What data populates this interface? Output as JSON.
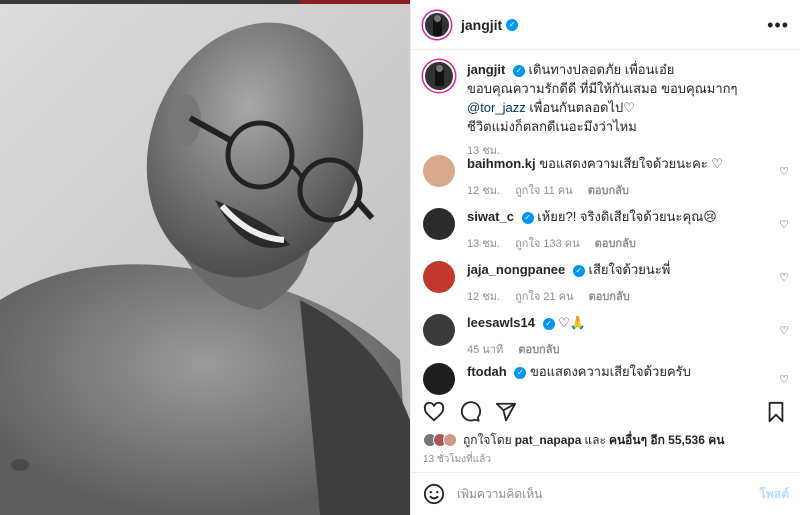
{
  "post": {
    "username": "jangjit",
    "more_icon": "more-horizontal-icon",
    "caption": {
      "username": "jangjit",
      "line1": "เดินทางปลอดภัย เพื่อนเอ๋ย",
      "line2": "ขอบคุณความรักดีดี ที่มีให้กันเสมอ ขอบคุณมากๆ",
      "mention": "@tor_jazz",
      "line3_rest": " เพื่อนกันตลอดไป♡",
      "line4": "ชีวิตแม่งก็ตลกดีเนอะมึงว่าไหม",
      "time": "13 ชม."
    }
  },
  "comments": [
    {
      "username": "baihmon.kj",
      "verified": false,
      "text": "ขอแสดงความเสียใจด้วยนะคะ ♡",
      "time": "12 ชม.",
      "likes": "ถูกใจ 11 คน",
      "reply": "ตอบกลับ",
      "avatar_color": "#d9a98c"
    },
    {
      "username": "siwat_c",
      "verified": true,
      "text": "เห้ยย?! จริงดิเสียใจด้วยนะคุณ😢",
      "time": "13 ชม.",
      "likes": "ถูกใจ 133 คน",
      "reply": "ตอบกลับ",
      "avatar_color": "#2b2b2b"
    },
    {
      "username": "jaja_nongpanee",
      "verified": true,
      "text": "เสียใจด้วยนะพี่",
      "time": "12 ชม.",
      "likes": "ถูกใจ 21 คน",
      "reply": "ตอบกลับ",
      "avatar_color": "#c0392b"
    },
    {
      "username": "leesawls14",
      "verified": true,
      "text": "♡🙏",
      "time": "45 นาที",
      "likes": "",
      "reply": "ตอบกลับ",
      "avatar_color": "#3a3a3a"
    },
    {
      "username": "ftodah",
      "verified": true,
      "text": "ขอแสดงความเสียใจด้วยครับ",
      "time": "",
      "likes": "",
      "reply": "",
      "avatar_color": "#1e1e1e"
    }
  ],
  "actions": {
    "like_icon": "heart-icon",
    "comment_icon": "comment-icon",
    "share_icon": "share-icon",
    "save_icon": "bookmark-icon"
  },
  "likes": {
    "prefix": "ถูกใจโดย",
    "user": "pat_napapa",
    "middle": "และ",
    "others": "คนอื่นๆ อีก 55,536 คน"
  },
  "timeago": "13 ชั่วโมงที่แล้ว",
  "add_comment": {
    "placeholder": "เพิ่มความคิดเห็น",
    "post_label": "โพสต์",
    "emoji_icon": "emoji-icon"
  },
  "colors": {
    "verified": "#0095f6",
    "post_disabled": "#b2dffc",
    "mention": "#00376b"
  }
}
